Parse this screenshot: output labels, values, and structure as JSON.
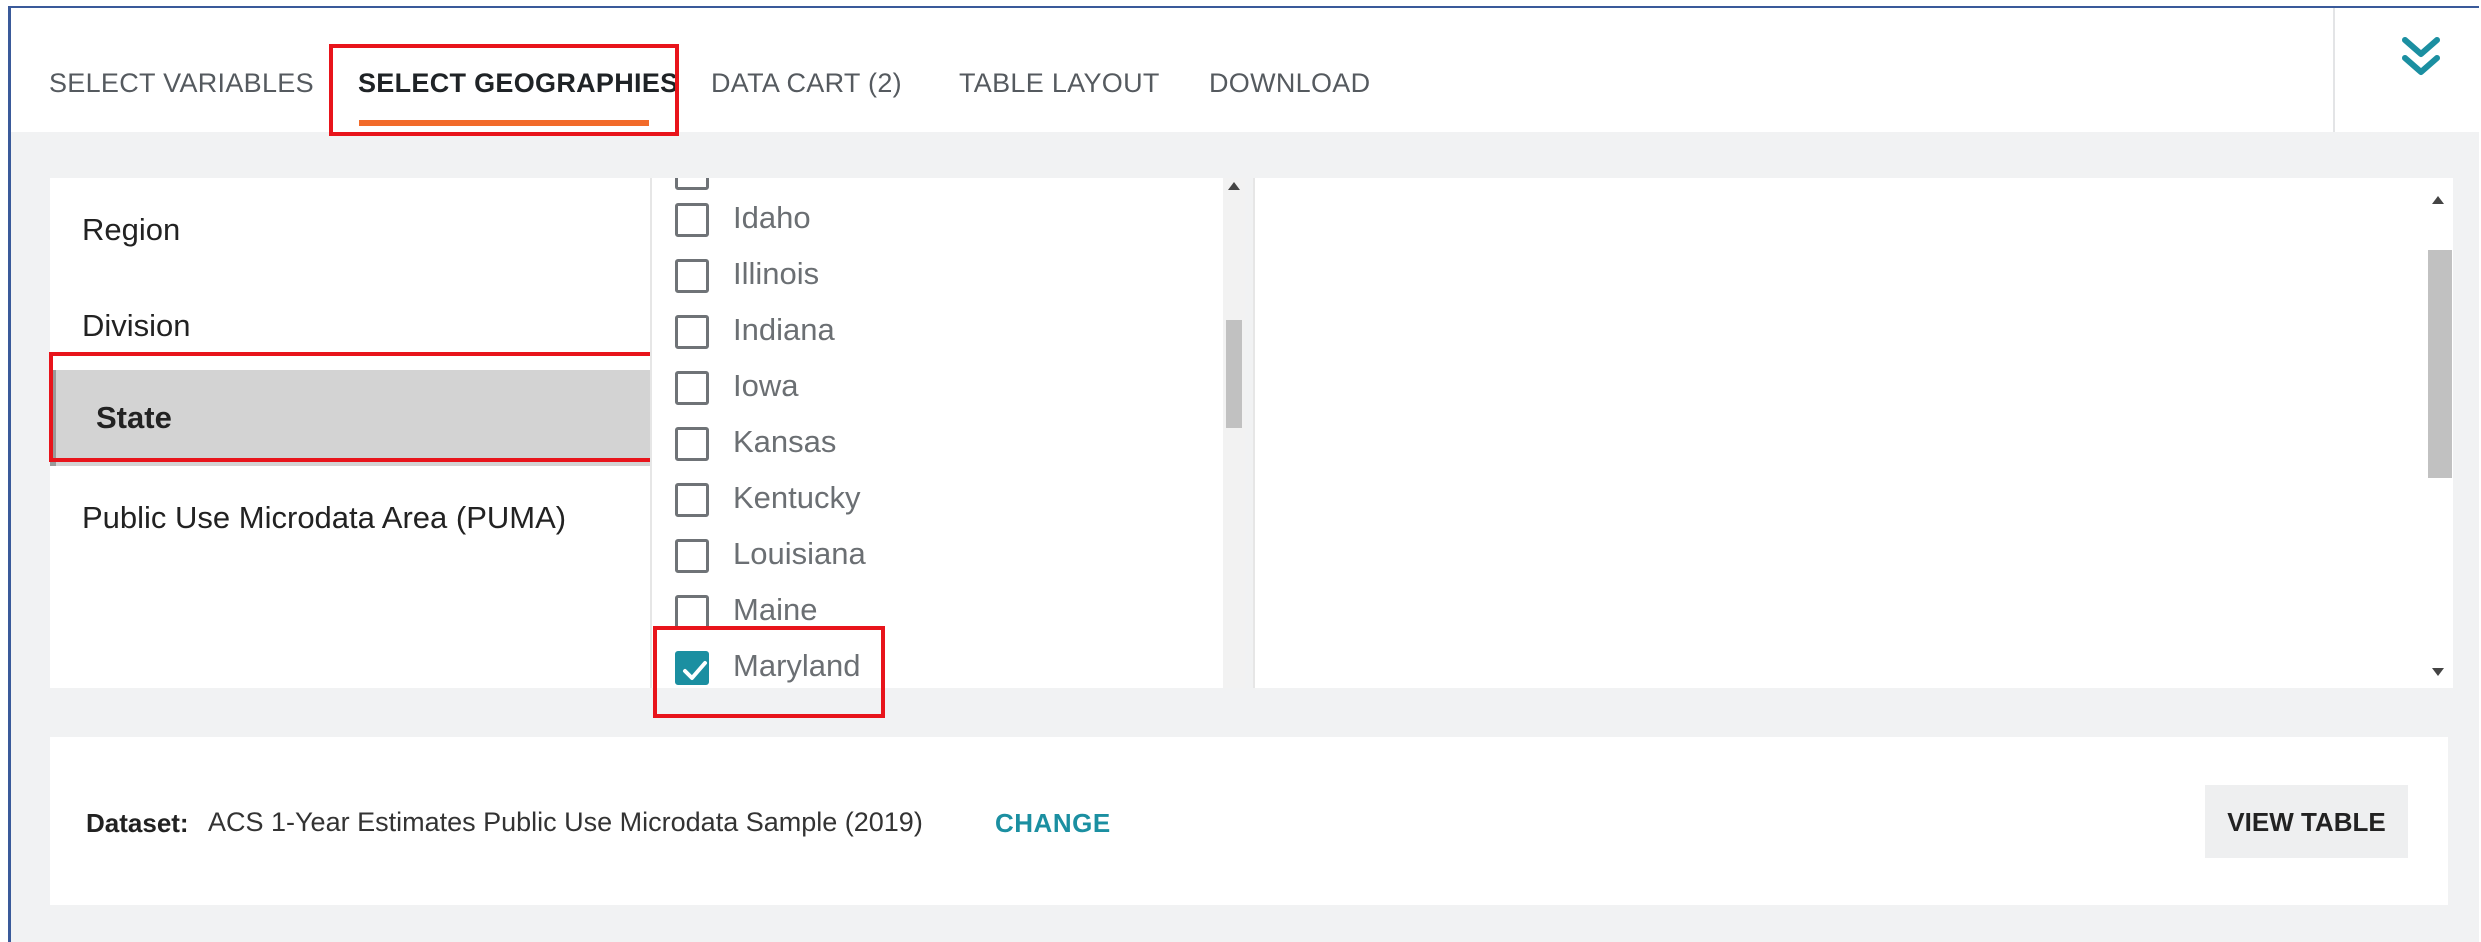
{
  "tabs": [
    {
      "label": "SELECT VARIABLES",
      "active": false
    },
    {
      "label": "SELECT GEOGRAPHIES",
      "active": true
    },
    {
      "label": "DATA CART (2)",
      "active": false
    },
    {
      "label": "TABLE LAYOUT",
      "active": false
    },
    {
      "label": "DOWNLOAD",
      "active": false
    }
  ],
  "collapse_icon": "double-chevron-down-icon",
  "geo_levels": [
    {
      "label": "Region",
      "selected": false
    },
    {
      "label": "Division",
      "selected": false
    },
    {
      "label": "State",
      "selected": true
    },
    {
      "label": "Public Use Microdata Area (PUMA)",
      "selected": false
    }
  ],
  "states": [
    {
      "label": "Idaho",
      "checked": false
    },
    {
      "label": "Illinois",
      "checked": false
    },
    {
      "label": "Indiana",
      "checked": false
    },
    {
      "label": "Iowa",
      "checked": false
    },
    {
      "label": "Kansas",
      "checked": false
    },
    {
      "label": "Kentucky",
      "checked": false
    },
    {
      "label": "Louisiana",
      "checked": false
    },
    {
      "label": "Maine",
      "checked": false
    },
    {
      "label": "Maryland",
      "checked": true
    }
  ],
  "footer": {
    "dataset_label": "Dataset:",
    "dataset_value": "ACS 1-Year Estimates Public Use Microdata Sample (2019)",
    "change_label": "CHANGE",
    "view_table_label": "VIEW TABLE"
  },
  "colors": {
    "accent": "#1b8fa1",
    "tab_underline": "#f26b2a",
    "highlight_box": "#e8141b"
  }
}
